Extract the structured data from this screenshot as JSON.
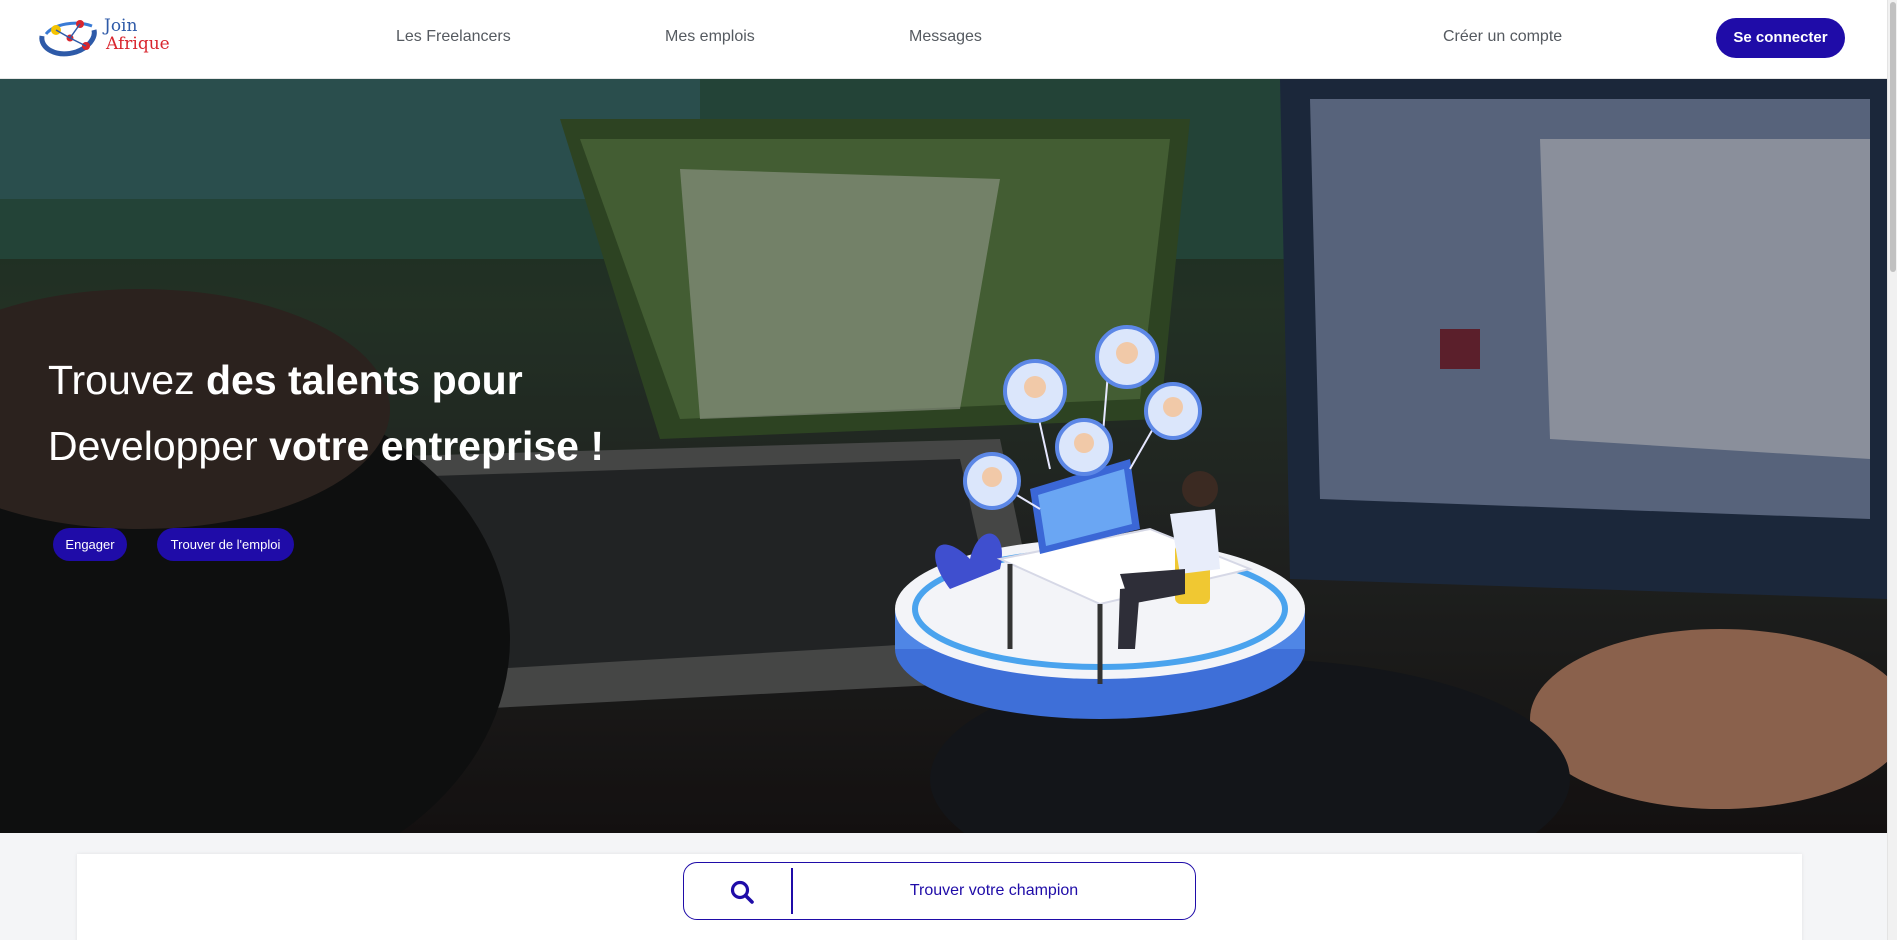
{
  "brand": {
    "name_line1": "Join",
    "name_line2": "Afrique",
    "colors": {
      "primary": "#1f0ca8",
      "logo_blue": "#2e5aa8",
      "logo_red": "#d9262e"
    }
  },
  "nav": {
    "links": [
      "Les Freelancers",
      "Mes emplois",
      "Messages"
    ],
    "signup": "Créer un compte",
    "login": "Se connecter"
  },
  "hero": {
    "title_line1_normal": "Trouvez ",
    "title_line1_bold": "des talents pour",
    "title_line2_normal": "Developper ",
    "title_line2_bold": "votre entreprise !",
    "buttons": [
      "Engager",
      "Trouver de l'emploi"
    ]
  },
  "search": {
    "icon": "search-icon",
    "label": "Trouver votre champion"
  }
}
